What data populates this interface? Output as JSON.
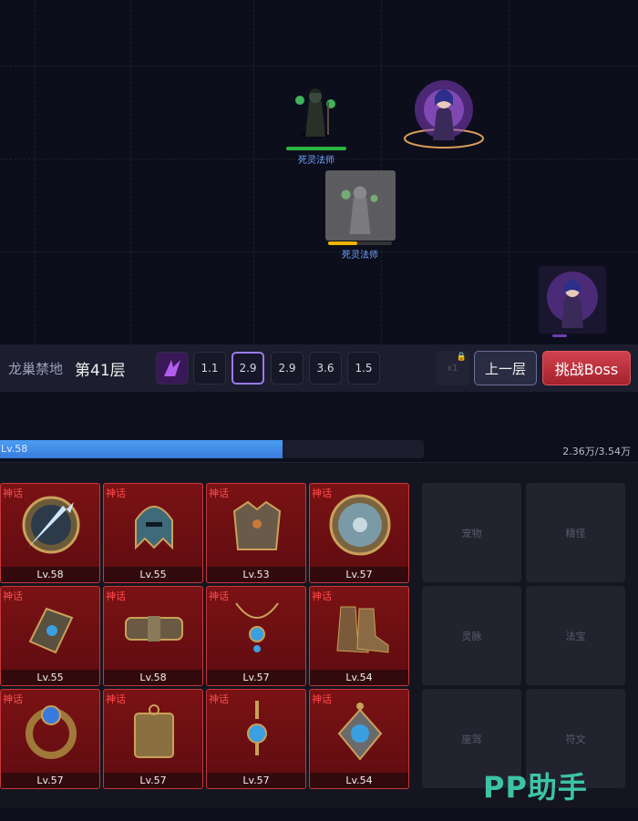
{
  "battle": {
    "enemies": [
      {
        "name": "死灵法师",
        "hp_fraction": 1.0,
        "hp_color": "#2bb53c"
      },
      {
        "name": "死灵法师",
        "hp_fraction": 0.45,
        "hp_color": "#f0b400"
      }
    ]
  },
  "floor": {
    "zone": "龙巢禁地",
    "level": "第41层",
    "speeds": [
      "1.1",
      "2.9",
      "2.9",
      "3.6",
      "1.5"
    ],
    "active_speed_index": 1,
    "multiplier": "x1",
    "prev_label": "上一层",
    "boss_label": "挑战Boss"
  },
  "xp": {
    "level": "Lv.58",
    "value": "2.36万/3.54万",
    "fraction": 0.667
  },
  "equipment": [
    {
      "rarity": "神话",
      "level": "Lv.58",
      "icon": "spear-shield-icon"
    },
    {
      "rarity": "神话",
      "level": "Lv.55",
      "icon": "helmet-icon"
    },
    {
      "rarity": "神话",
      "level": "Lv.53",
      "icon": "chest-armor-icon"
    },
    {
      "rarity": "神话",
      "level": "Lv.57",
      "icon": "round-shield-icon"
    },
    {
      "rarity": "神话",
      "level": "Lv.55",
      "icon": "bracer-icon"
    },
    {
      "rarity": "神话",
      "level": "Lv.58",
      "icon": "belt-icon"
    },
    {
      "rarity": "神话",
      "level": "Lv.57",
      "icon": "necklace-icon"
    },
    {
      "rarity": "神话",
      "level": "Lv.54",
      "icon": "boots-icon"
    },
    {
      "rarity": "神话",
      "level": "Lv.57",
      "icon": "ring-icon"
    },
    {
      "rarity": "神话",
      "level": "Lv.57",
      "icon": "token-icon"
    },
    {
      "rarity": "神话",
      "level": "Lv.57",
      "icon": "earring-icon"
    },
    {
      "rarity": "神话",
      "level": "Lv.54",
      "icon": "amulet-icon"
    }
  ],
  "side_buttons": [
    "宠物",
    "精怪",
    "灵脉",
    "法宝",
    "座驾",
    "符文"
  ],
  "watermark": "PP助手",
  "colors": {
    "accent_purple": "#9a7ae8",
    "boss_red": "#c0323d",
    "xp_blue": "#3f8de6",
    "mythic_red": "#ff4c4c"
  }
}
